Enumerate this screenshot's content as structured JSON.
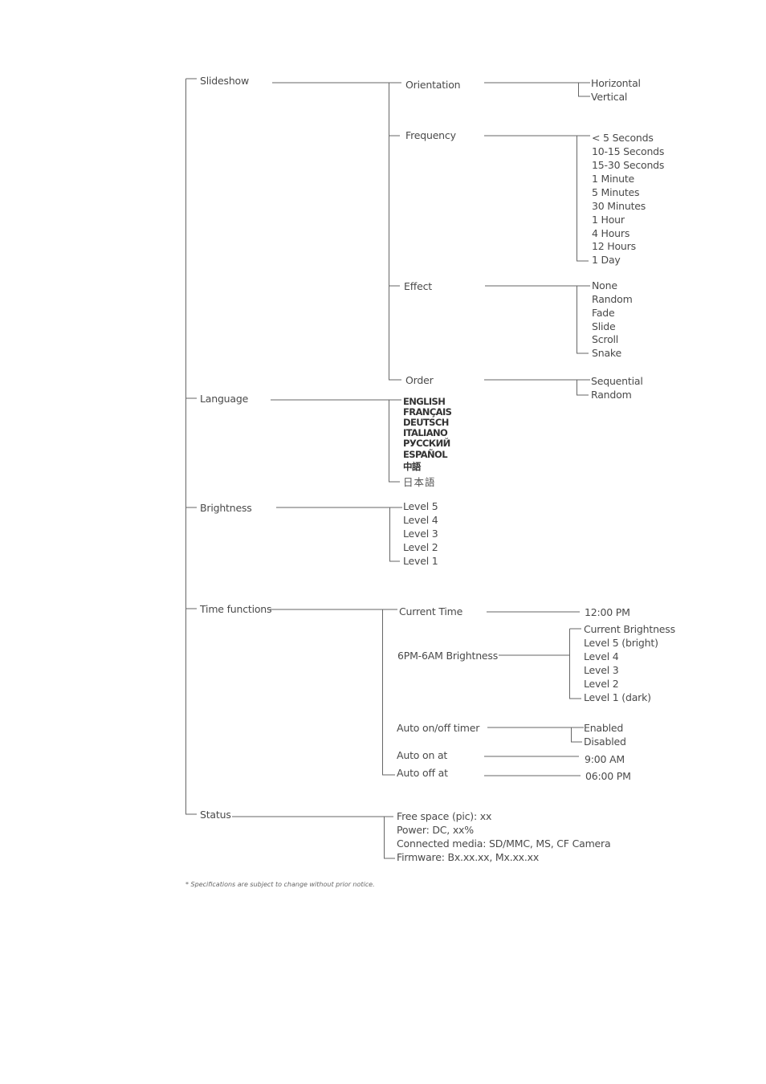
{
  "menu_tree": {
    "root_items": [
      {
        "label": "Slideshow",
        "children": [
          {
            "label": "Orientation",
            "options": [
              "Horizontal",
              "Vertical"
            ]
          },
          {
            "label": "Frequency",
            "options": [
              "< 5 Seconds",
              "10-15 Seconds",
              "15-30 Seconds",
              "1 Minute",
              "5 Minutes",
              "30 Minutes",
              "1 Hour",
              "4 Hours",
              "12 Hours",
              "1 Day"
            ]
          },
          {
            "label": "Effect",
            "options": [
              "None",
              "Random",
              "Fade",
              "Slide",
              "Scroll",
              "Snake"
            ]
          },
          {
            "label": "Order",
            "options": [
              "Sequential",
              "Random"
            ]
          }
        ]
      },
      {
        "label": "Language",
        "options": [
          "ENGLISH",
          "FRANÇAIS",
          "DEUTSCH",
          "ITALIANO",
          "РУССКИЙ",
          "ESPAÑOL",
          "中語",
          "日本語"
        ]
      },
      {
        "label": "Brightness",
        "options": [
          "Level 5",
          "Level 4",
          "Level 3",
          "Level 2",
          "Level 1"
        ]
      },
      {
        "label": "Time functions",
        "children": [
          {
            "label": "Current Time",
            "options": [
              "12:00 PM"
            ]
          },
          {
            "label": "6PM-6AM Brightness",
            "options": [
              "Current Brightness",
              "Level 5 (bright)",
              "Level 4",
              "Level 3",
              "Level 2",
              "Level 1 (dark)"
            ]
          },
          {
            "label": "Auto on/off timer",
            "options": [
              "Enabled",
              "Disabled"
            ]
          },
          {
            "label": "Auto on at",
            "options": [
              "9:00 AM"
            ]
          },
          {
            "label": "Auto off at",
            "options": [
              "06:00 PM"
            ]
          }
        ]
      },
      {
        "label": "Status",
        "options": [
          "Free space (pic): xx",
          "Power: DC, xx%",
          "Connected media: SD/MMC, MS, CF Camera",
          "Firmware: Bx.xx.xx, Mx.xx.xx"
        ]
      }
    ]
  },
  "footnote": "* Specifications are subject to change without prior notice."
}
